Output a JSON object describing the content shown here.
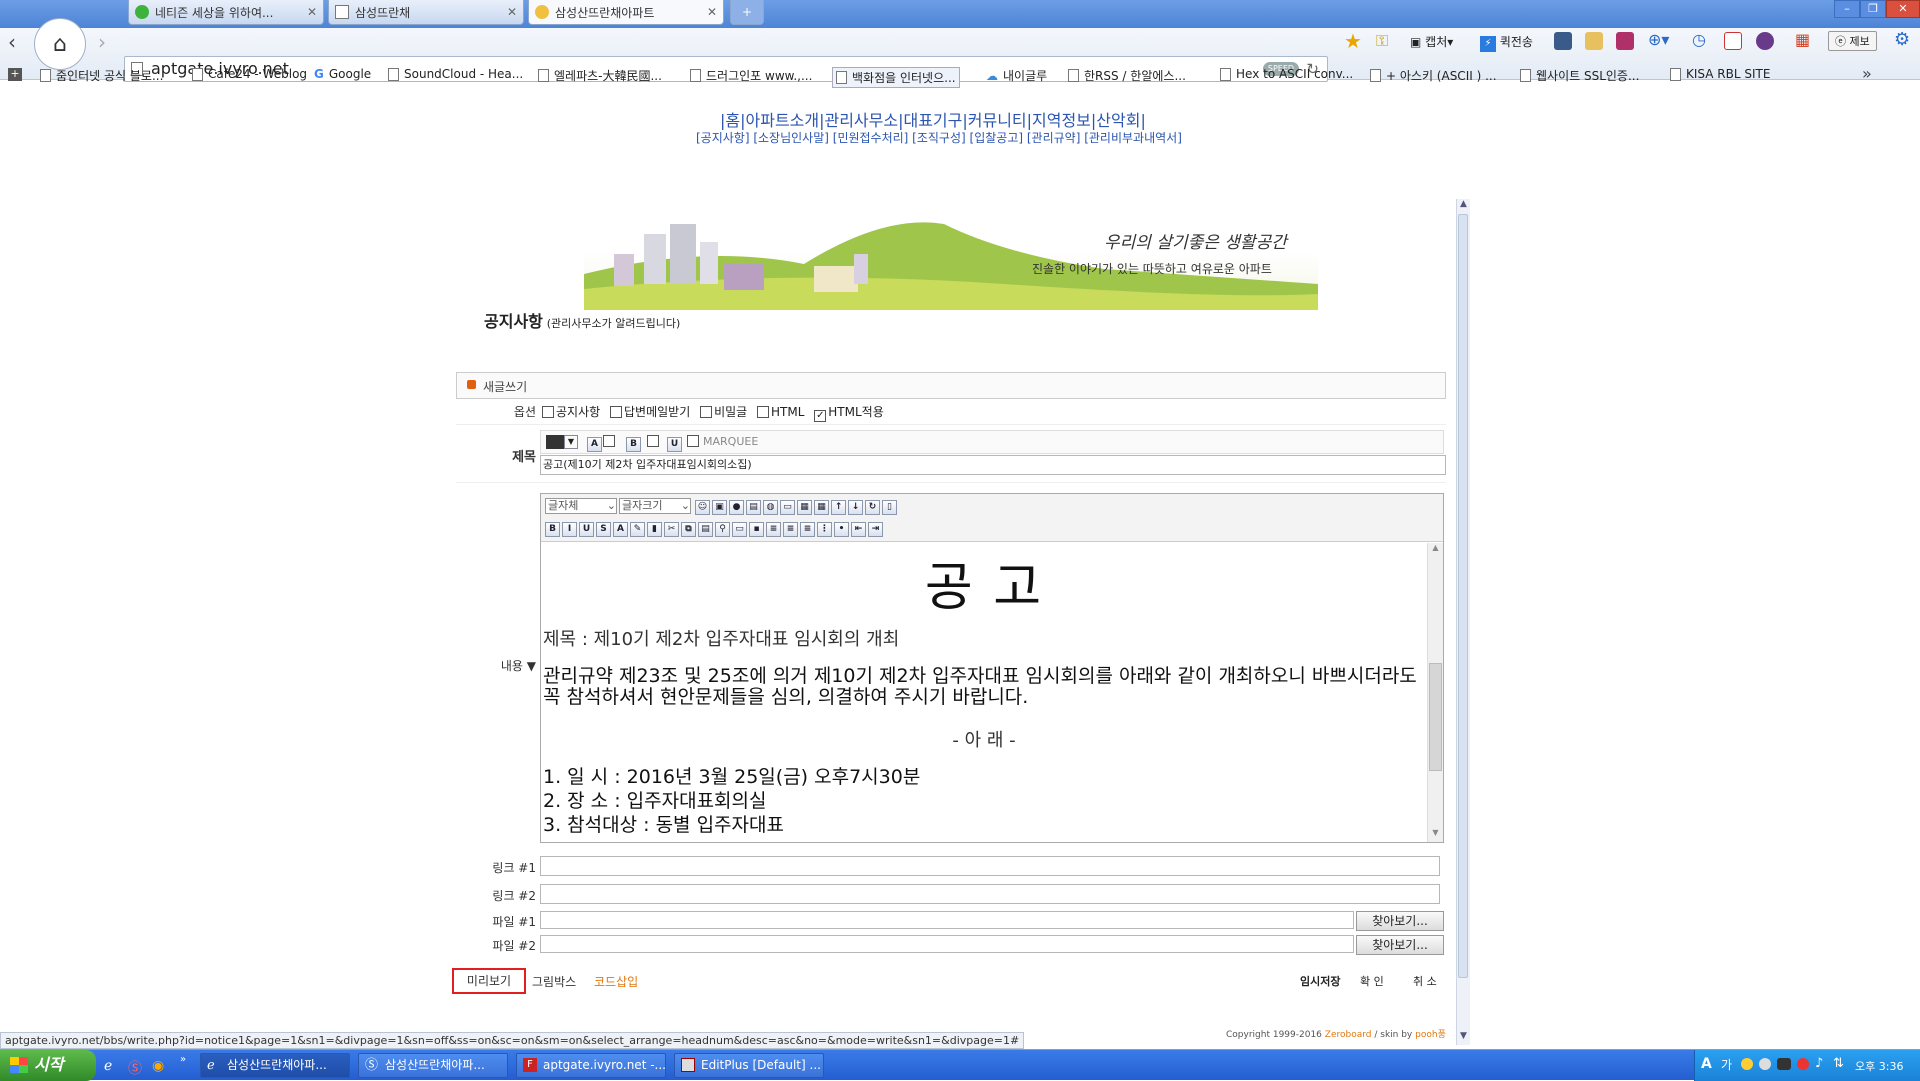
{
  "browser": {
    "tabs": [
      {
        "title": "네티즌 세상을 위하여..."
      },
      {
        "title": "삼성뜨란채"
      },
      {
        "title": "삼성산뜨란채아파트"
      }
    ],
    "url": "aptgate.ivyro.net",
    "speed_badge": "SPEED",
    "toolbar_items": {
      "capture": "캡처",
      "quick_send": "퀵전송",
      "jebo": "제보"
    },
    "bookmarks": [
      "줌인터넷 공식 블로...",
      "Cafe24 - Weblog",
      "Google",
      "SoundCloud - Hea...",
      "엘레파츠-大韓民國...",
      "드러그인포 www.,...",
      "백화점을 인터넷으...",
      "내이글루",
      "한RSS / 한알에스...",
      "Hex to ASCII conv...",
      "+ 아스키 (ASCII ) ...",
      "웹사이트 SSL인증...",
      "KISA RBL SITE"
    ],
    "status_url": "aptgate.ivyro.net/bbs/write.php?id=notice1&page=1&sn1=&divpage=1&sn=off&ss=on&sc=on&sm=on&select_arrange=headnum&desc=asc&no=&mode=write&sn1=&divpage=1#"
  },
  "site": {
    "main_nav": "|홈|아파트소개|관리사무소|대표기구|커뮤니티|지역정보|산악회|",
    "sub_nav": "[공지사항] [소장님인사말] [민원접수처리] [조직구성] [입찰공고] [관리규약] [관리비부과내역서]",
    "banner_slogan": "우리의 살기좋은 생활공간",
    "banner_sub": "진솔한 이야기가 있는 따뜻하고 여유로운 아파트",
    "board_title": "공지사항",
    "board_subtitle": "(관리사무소가 알려드립니다)",
    "copyright": "Copyright 1999-2016",
    "zeroboard": "Zeroboard",
    "skin": "/ skin by",
    "skin_author": "pooh풍"
  },
  "form": {
    "section_title": "새글쓰기",
    "options_label": "옵션",
    "options": [
      {
        "label": "공지사항",
        "checked": false
      },
      {
        "label": "답변메일받기",
        "checked": false
      },
      {
        "label": "비밀글",
        "checked": false
      },
      {
        "label": "HTML",
        "checked": false
      },
      {
        "label": "HTML적용",
        "checked": true
      }
    ],
    "subject_label": "제목",
    "marquee_label": "MARQUEE",
    "subject_value": "공고(제10기 제2차 입주자대표임시회의소집)",
    "content_label": "내용",
    "font_select": "글자체",
    "size_select": "글자크기",
    "link1_label": "링크 #1",
    "link2_label": "링크 #2",
    "file1_label": "파일 #1",
    "file2_label": "파일 #2",
    "browse_label": "찾아보기...",
    "preview_label": "미리보기",
    "picturebox_label": "그림박스",
    "code_label": "코드삽입",
    "temp_save_label": "임시저장",
    "confirm_label": "확 인",
    "cancel_label": "취 소"
  },
  "document": {
    "heading": "공 고",
    "subject_line": "제목 : 제10기 제2차 입주자대표 임시회의 개최",
    "body": "관리규약 제23조 및 25조에 의거 제10기 제2차 입주자대표 임시회의를 아래와 같이 개최하오니 바쁘시더라도 꼭 참석하셔서 현안문제들을 심의, 의결하여 주시기 바랍니다.",
    "separator": "- 아 래 -",
    "items": [
      "1. 일 시 : 2016년 3월 25일(금) 오후7시30분",
      "2. 장 소 : 입주자대표회의실",
      "3. 참석대상 : 동별 입주자대표"
    ]
  },
  "taskbar": {
    "start": "시작",
    "tasks": [
      "삼성산뜨란채아파...",
      "삼성산뜨란채아파...",
      "aptgate.ivyro.net -...",
      "EditPlus [Default] ..."
    ],
    "clock": "오후 3:36"
  }
}
